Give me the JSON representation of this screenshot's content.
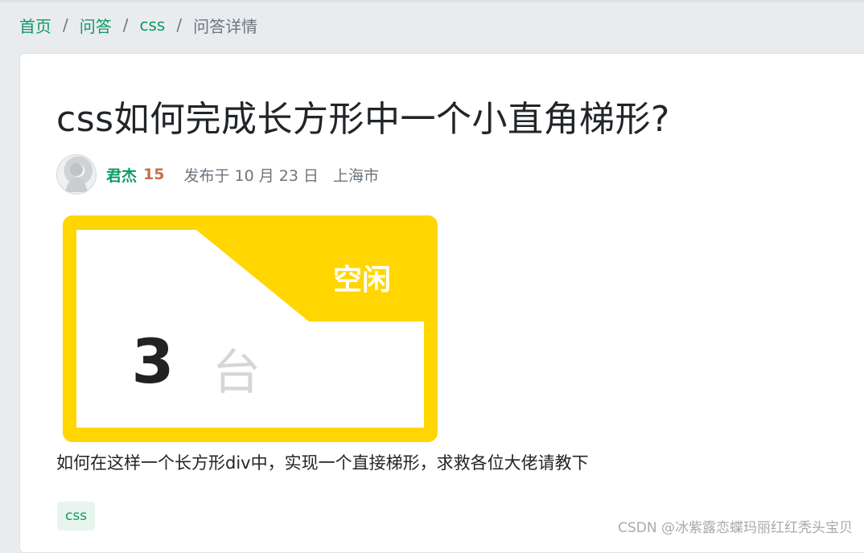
{
  "breadcrumb": {
    "items": [
      "首页",
      "问答",
      "css"
    ],
    "current": "问答详情",
    "separator": "/"
  },
  "question": {
    "title": "css如何完成长方形中一个小直角梯形?",
    "author": "君杰",
    "reputation": "15",
    "published": "发布于 10 月 23 日",
    "location": "上海市",
    "body": "如何在这样一个长方形div中，实现一个直接梯形，求救各位大佬请教下",
    "tag": "css"
  },
  "illustration": {
    "status_label": "空闲",
    "count": "3",
    "unit": "台",
    "accent_color": "#ffd600"
  },
  "watermark": "CSDN @冰紫露恋蝶玛丽红红秃头宝贝",
  "icons": {
    "avatar": "user-avatar-image"
  }
}
